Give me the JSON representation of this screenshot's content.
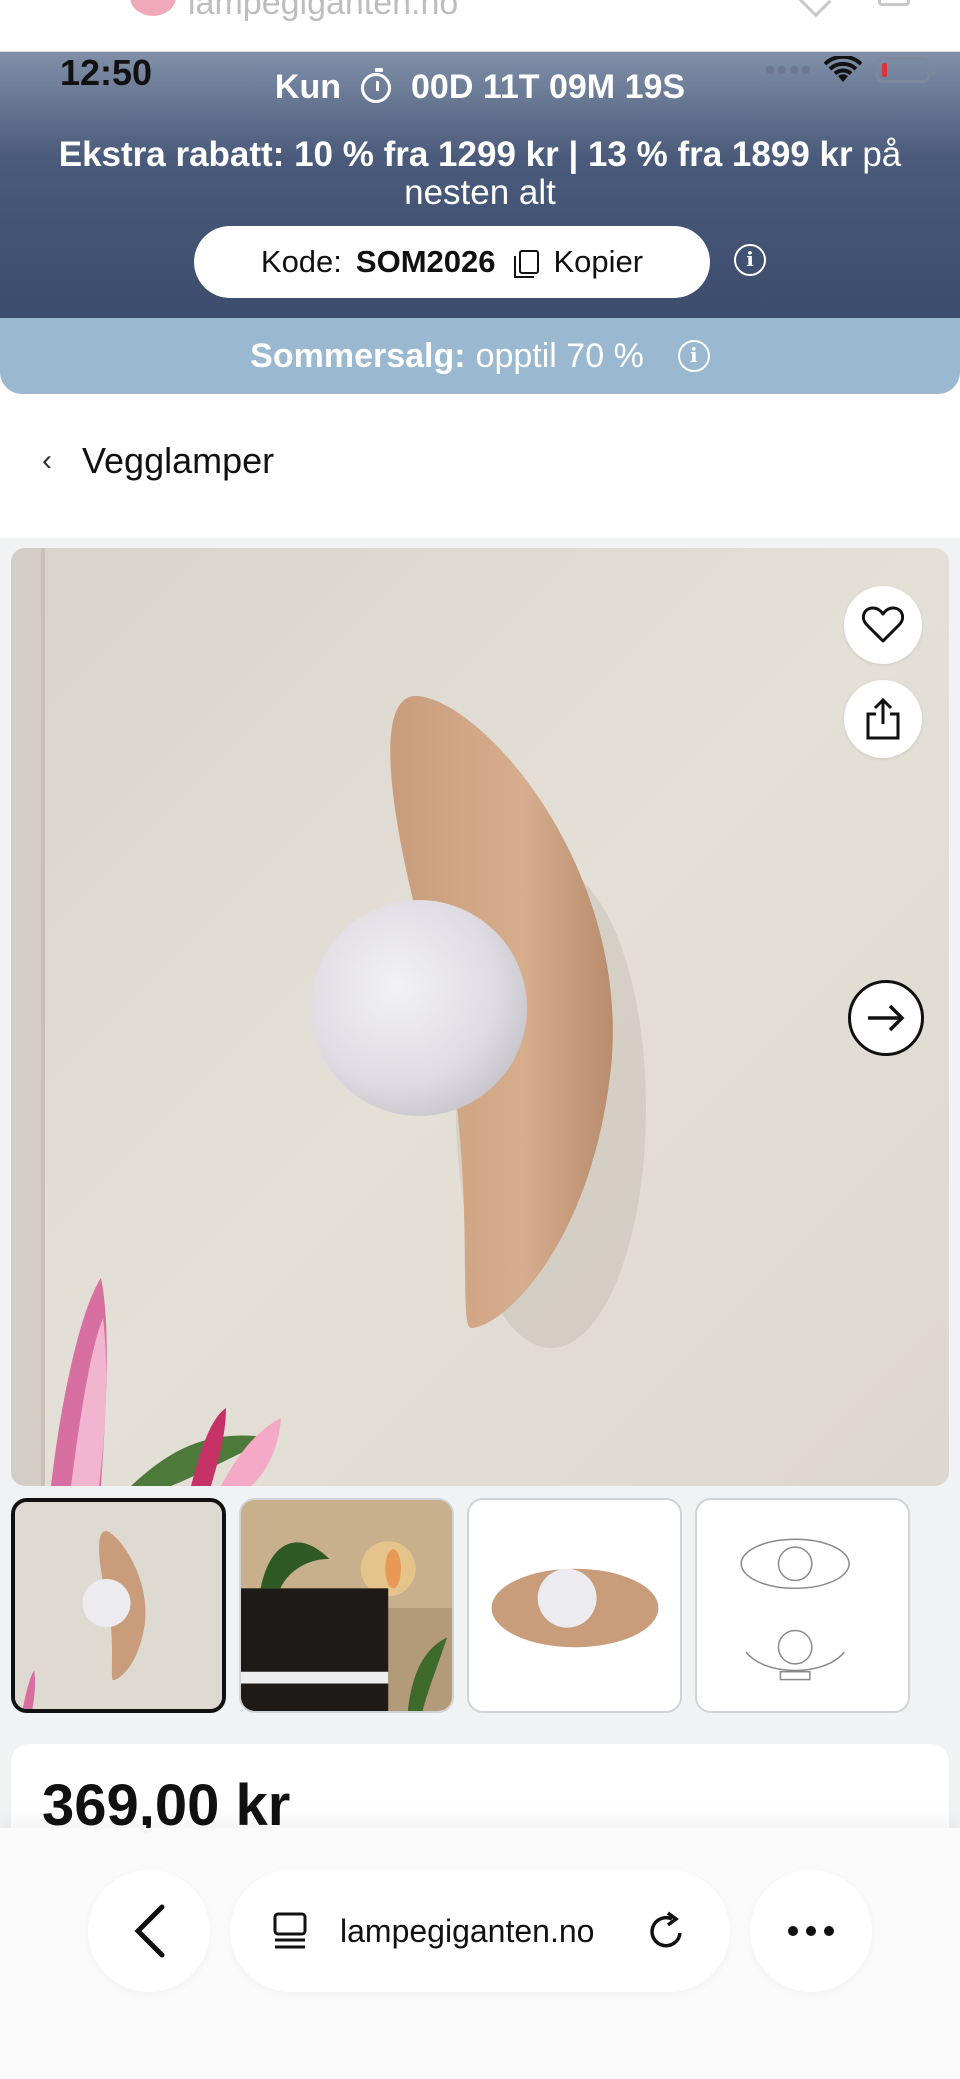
{
  "status_bar": {
    "time": "12:50"
  },
  "site_header": {
    "logo_text": "lampegiganten.no"
  },
  "promo": {
    "countdown_prefix": "Kun",
    "countdown_value": "00D 11T 09M 19S",
    "extra_bold": "Ekstra rabatt: 10 % fra 1299 kr | 13 % fra 1899 kr",
    "extra_rest": "på nesten alt",
    "code_label": "Kode:",
    "code_value": "SOM2026",
    "copy_label": "Kopier"
  },
  "summer": {
    "bold": "Sommersalg:",
    "rest": "opptil 70 %"
  },
  "breadcrumb": {
    "label": "Vegglamper"
  },
  "product": {
    "price": "369,00 kr"
  },
  "browser": {
    "url": "lampegiganten.no"
  },
  "colors": {
    "promo_dark": "#3c4c6c",
    "summer_blue": "#9ab8cf",
    "shade_tan": "#c9a07e"
  },
  "icons": [
    "timer-icon",
    "copy-icon",
    "info-icon",
    "chevron-left-icon",
    "heart-icon",
    "share-icon",
    "arrow-right-icon",
    "tabs-icon",
    "reload-icon",
    "more-icon"
  ]
}
